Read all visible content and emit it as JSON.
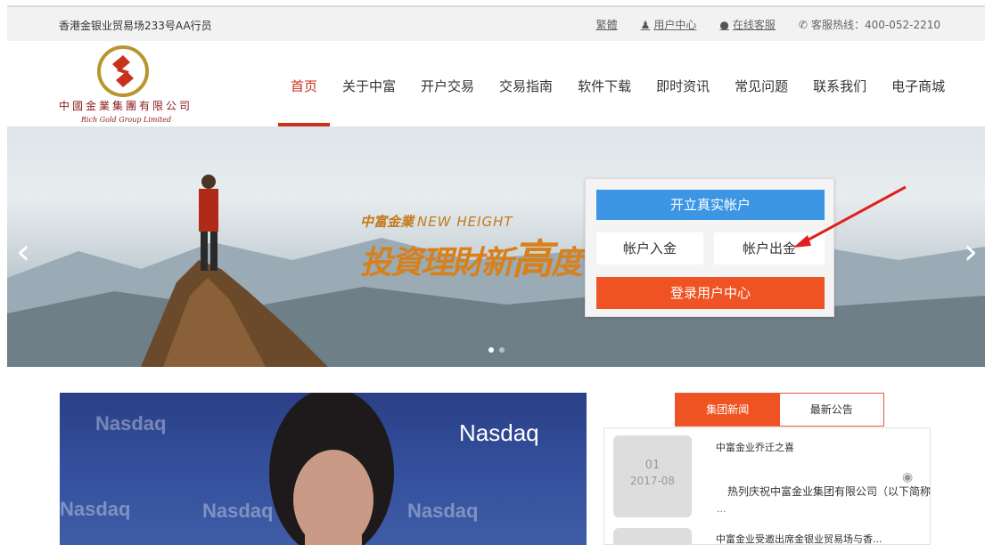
{
  "topbar": {
    "address": "香港金银业贸易场233号AA行员",
    "traditional": "繁體",
    "user_center": "用户中心",
    "online_service": "在线客服",
    "hotline": "客服热线：400-052-2210"
  },
  "logo": {
    "cn_name": "中國金業集團有限公司",
    "en_name": "Rich Gold Group Limited"
  },
  "nav": {
    "items": [
      "首页",
      "关于中富",
      "开户交易",
      "交易指南",
      "软件下载",
      "即时资讯",
      "常见问题",
      "联系我们",
      "电子商城"
    ],
    "active": "首页"
  },
  "banner": {
    "slogan_top": "中富金業",
    "slogan_en": "NEW HEIGHT",
    "slogan_big_a": "投資理財新",
    "slogan_big_b": "高",
    "slogan_big_c": "度",
    "prev": "‹",
    "next": "›",
    "open_account": "开立真实帐户",
    "deposit": "帐户入金",
    "withdraw": "帐户出金",
    "login": "登录用户中心"
  },
  "video": {
    "brand": "Nasdaq"
  },
  "news": {
    "tabs": [
      "集团新闻",
      "最新公告"
    ],
    "active_tab": "集团新闻",
    "items": [
      {
        "day": "01",
        "year_month": "2017-08",
        "title": "中富金业乔迁之喜",
        "summary": "热列庆祝中富金业集团有限公司（以下简称",
        "more": "..."
      },
      {
        "title": "中富金业受邀出席金银业贸易场与香..."
      }
    ]
  },
  "colors": {
    "accent_red": "#c8311c",
    "button_blue": "#3c96e4",
    "button_orange": "#ef5323"
  }
}
